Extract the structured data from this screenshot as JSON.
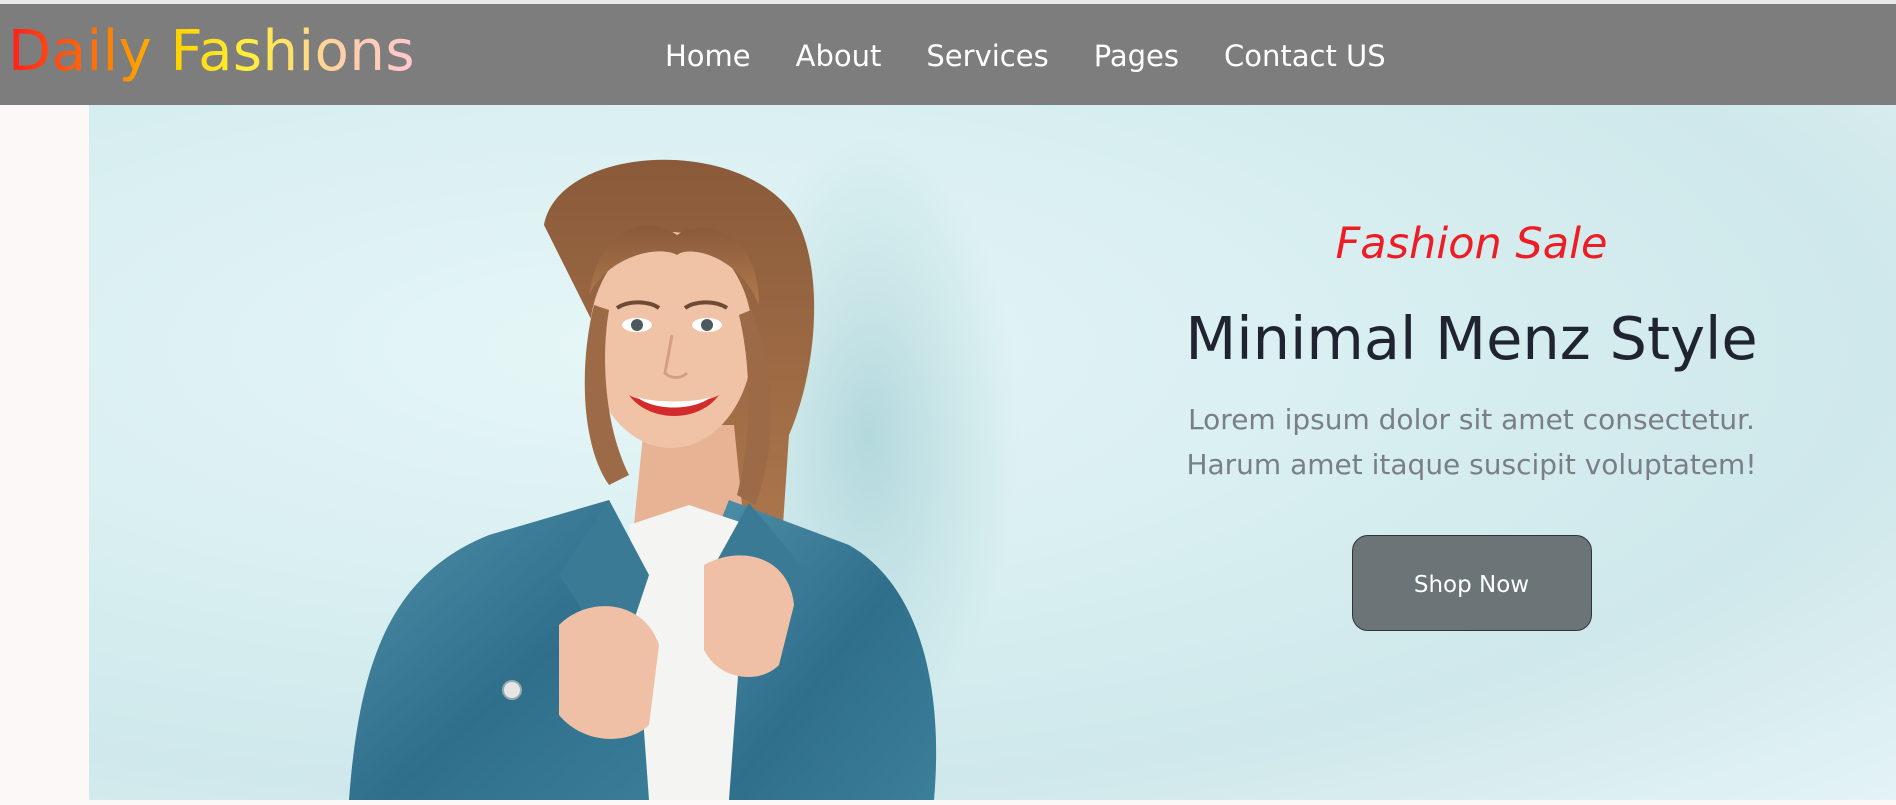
{
  "header": {
    "brand": "Daily Fashions",
    "nav": [
      {
        "label": "Home"
      },
      {
        "label": "About"
      },
      {
        "label": "Services"
      },
      {
        "label": "Pages"
      },
      {
        "label": "Contact US"
      }
    ]
  },
  "hero": {
    "eyebrow": "Fashion Sale",
    "title": "Minimal Menz Style",
    "description": "Lorem ipsum dolor sit amet consectetur. Harum amet itaque suscipit voluptatem!",
    "button_label": "Shop Now",
    "image_subject": "smiling woman in denim jacket"
  },
  "colors": {
    "navbar": "#7d7d7d",
    "accent_red": "#ee1c25",
    "button": "#6b7476",
    "hero_bg": "#d7eef0"
  }
}
